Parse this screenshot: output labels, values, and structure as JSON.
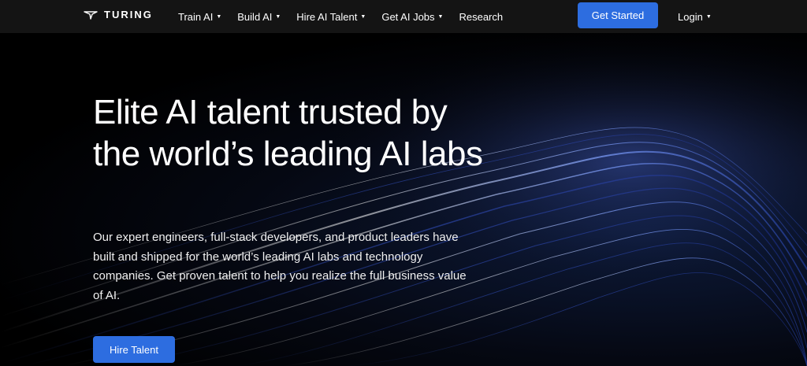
{
  "brand": {
    "name": "TURING"
  },
  "nav": {
    "items": [
      {
        "label": "Train AI",
        "has_dropdown": true
      },
      {
        "label": "Build AI",
        "has_dropdown": true
      },
      {
        "label": "Hire AI Talent",
        "has_dropdown": true
      },
      {
        "label": "Get AI Jobs",
        "has_dropdown": true
      },
      {
        "label": "Research",
        "has_dropdown": false
      }
    ],
    "cta_label": "Get Started",
    "login_label": "Login"
  },
  "hero": {
    "headline": "Elite AI talent trusted by the world’s leading AI labs",
    "subtext": "Our expert engineers, full-stack developers, and product leaders have built and shipped for the world’s leading AI labs and technology companies. Get proven talent to help you realize the full business value of AI.",
    "button_label": "Hire Talent"
  },
  "colors": {
    "accent": "#2d6de0",
    "navbar_bg": "#141414",
    "hero_bg": "#000000"
  }
}
